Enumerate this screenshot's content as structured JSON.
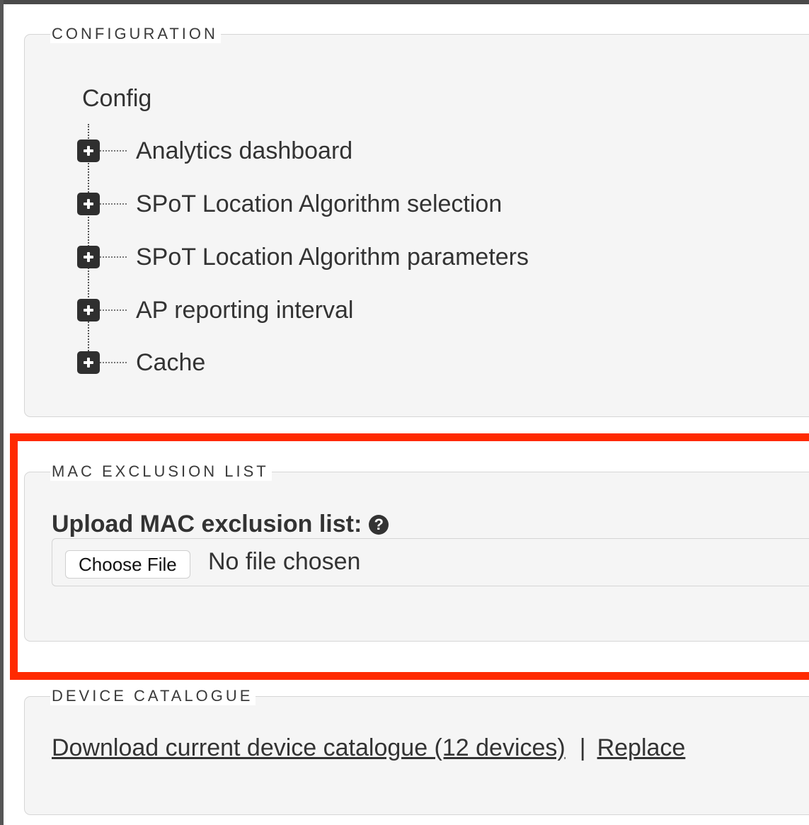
{
  "configuration": {
    "legend": "CONFIGURATION",
    "root_label": "Config",
    "items": [
      {
        "label": "Analytics dashboard"
      },
      {
        "label": "SPoT Location Algorithm selection"
      },
      {
        "label": "SPoT Location Algorithm parameters"
      },
      {
        "label": "AP reporting interval"
      },
      {
        "label": "Cache"
      }
    ],
    "expand_icon": "plus-square-icon"
  },
  "mac_exclusion": {
    "legend": "MAC EXCLUSION LIST",
    "upload_label": "Upload MAC exclusion list:",
    "help_glyph": "?",
    "choose_file_label": "Choose File",
    "file_status": "No file chosen",
    "highlight_color": "#ff2a00"
  },
  "device_catalogue": {
    "legend": "DEVICE CATALOGUE",
    "download_link": "Download current device catalogue (12 devices)",
    "separator": "|",
    "replace_link": "Replace"
  }
}
